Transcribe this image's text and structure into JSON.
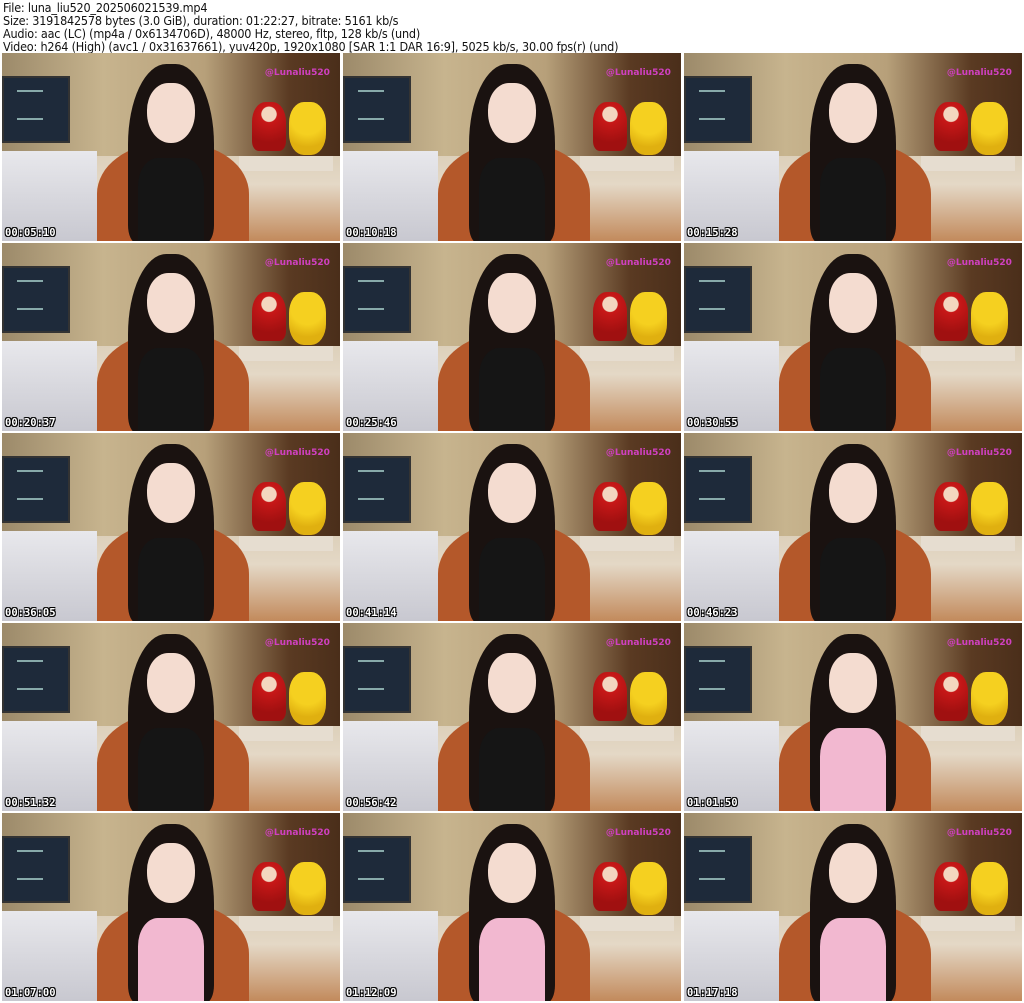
{
  "header": {
    "file": "File: luna_liu520_202506021539.mp4",
    "size": "Size: 3191842578 bytes (3.0 GiB), duration: 01:22:27, bitrate: 5161 kb/s",
    "audio": "Audio: aac (LC) (mp4a / 0x6134706D), 48000 Hz, stereo, fltp, 128 kb/s (und)",
    "video": "Video: h264 (High) (avc1 / 0x31637661), yuv420p, 1920x1080 [SAR 1:1 DAR 16:9], 5025 kb/s, 30.00 fps(r) (und)"
  },
  "watermark": "@Lunaliu520",
  "thumbnails": [
    {
      "time": "00:05:10",
      "outfit": "#151515"
    },
    {
      "time": "00:10:18",
      "outfit": "#151515"
    },
    {
      "time": "00:15:28",
      "outfit": "#151515"
    },
    {
      "time": "00:20:37",
      "outfit": "#151515"
    },
    {
      "time": "00:25:46",
      "outfit": "#151515"
    },
    {
      "time": "00:30:55",
      "outfit": "#151515"
    },
    {
      "time": "00:36:05",
      "outfit": "#151515"
    },
    {
      "time": "00:41:14",
      "outfit": "#151515"
    },
    {
      "time": "00:46:23",
      "outfit": "#151515"
    },
    {
      "time": "00:51:32",
      "outfit": "#151515"
    },
    {
      "time": "00:56:42",
      "outfit": "#151515"
    },
    {
      "time": "01:01:50",
      "outfit": "#f2b8d0"
    },
    {
      "time": "01:07:00",
      "outfit": "#f2b8d0"
    },
    {
      "time": "01:12:09",
      "outfit": "#f2b8d0"
    },
    {
      "time": "01:17:18",
      "outfit": "#f2b8d0"
    }
  ]
}
